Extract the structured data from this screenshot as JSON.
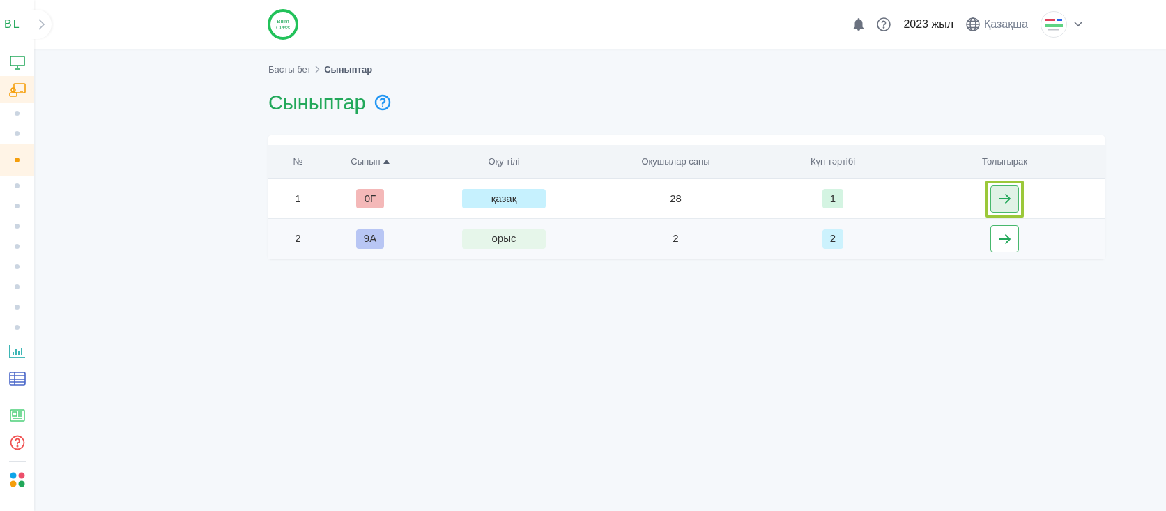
{
  "sidebar": {
    "logo": "BL",
    "items": [
      {
        "kind": "monitor",
        "selected": false
      },
      {
        "kind": "classroom",
        "selected": true
      },
      {
        "kind": "dot",
        "selected": false
      },
      {
        "kind": "dot",
        "selected": false
      },
      {
        "kind": "dot",
        "selected": true
      },
      {
        "kind": "dot",
        "selected": false
      },
      {
        "kind": "dot",
        "selected": false
      },
      {
        "kind": "dot",
        "selected": false
      },
      {
        "kind": "dot",
        "selected": false
      },
      {
        "kind": "dot",
        "selected": false
      },
      {
        "kind": "dot",
        "selected": false
      },
      {
        "kind": "dot",
        "selected": false
      },
      {
        "kind": "dot",
        "selected": false
      },
      {
        "kind": "chart",
        "selected": false
      },
      {
        "kind": "table",
        "selected": false
      },
      {
        "kind": "divider",
        "selected": false
      },
      {
        "kind": "news",
        "selected": false
      },
      {
        "kind": "help",
        "selected": false
      },
      {
        "kind": "divider",
        "selected": false
      },
      {
        "kind": "apps",
        "selected": false
      }
    ]
  },
  "header": {
    "logo_lines": [
      "Bilim",
      "Class"
    ],
    "year": "2023 жыл",
    "language": "Қазақша"
  },
  "breadcrumb": [
    "Басты бет",
    "Сыныптар"
  ],
  "title": "Сыныптар",
  "table": {
    "columns": [
      {
        "label": "№",
        "sorted": false
      },
      {
        "label": "Сынып",
        "sorted": true
      },
      {
        "label": "Оқу тілі",
        "sorted": false
      },
      {
        "label": "Оқушылар саны",
        "sorted": false
      },
      {
        "label": "Күн тәртібі",
        "sorted": false
      },
      {
        "label": "Толығырақ",
        "sorted": false
      }
    ],
    "rows": [
      {
        "number": "1",
        "class": {
          "text": "0Г",
          "color": "#f4b8b8"
        },
        "language": {
          "text": "қазақ",
          "color": "#c6f1fe"
        },
        "students": "28",
        "shift": {
          "text": "1",
          "color": "#d4f4e2"
        },
        "highlighted": true
      },
      {
        "number": "2",
        "class": {
          "text": "9А",
          "color": "#b8c6f4"
        },
        "language": {
          "text": "орыс",
          "color": "#e6f6ea"
        },
        "students": "2",
        "shift": {
          "text": "2",
          "color": "#ccf2fd"
        },
        "highlighted": false
      }
    ]
  }
}
